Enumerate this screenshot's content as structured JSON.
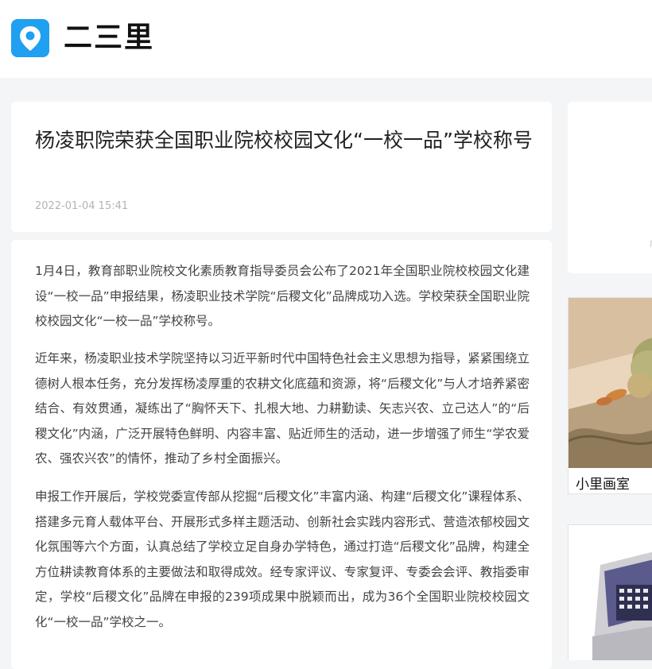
{
  "header": {
    "logo_icon": "location-pin-icon",
    "brand": "二三里",
    "accent_color": "#1fa0f0"
  },
  "article": {
    "title": "杨凌职院荣获全国职业院校校园文化“一校一品”学校称号",
    "date": "2022-01-04 15:41",
    "paragraphs": [
      "1月4日，教育部职业院校文化素质教育指导委员会公布了2021年全国职业院校校园文化建设“一校一品”申报结果，杨凌职业技术学院“后稷文化”品牌成功入选。学校荣获全国职业院校校园文化“一校一品”学校称号。",
      "近年来，杨凌职业技术学院坚持以习近平新时代中国特色社会主义思想为指导，紧紧围绕立德树人根本任务，充分发挥杨凌厚重的农耕文化底蕴和资源，将“后稷文化”与人才培养紧密结合、有效贯通，凝练出了“胸怀天下、扎根大地、力耕勤读、矢志兴农、立己达人”的“后稷文化”内涵，广泛开展特色鲜明、内容丰富、贴近师生的活动，进一步增强了师生“学农爱农、强农兴农”的情怀，推动了乡村全面振兴。",
      "申报工作开展后，学校党委宣传部从挖掘“后稷文化”丰富内涵、构建“后稷文化”课程体系、搭建多元育人载体平台、开展形式多样主题活动、创新社会实践内容形式、营造浓郁校园文化氛围等六个方面，认真总结了学校立足自身办学特色，通过打造“后稷文化”品牌，构建全方位耕读教育体系的主要做法和取得成效。经专家评议、专家复评、专委会会评、教指委审定，学校“后稷文化”品牌在申报的239项成果中脱颖而出，成为36个全国职业院校校园文化“一校一品”学校之一。"
    ]
  },
  "sidebar": {
    "ad_mark": "广",
    "item1_caption": "小里画室",
    "item1_image": "still-life-painting-image",
    "item2_image": "device-product-image"
  }
}
